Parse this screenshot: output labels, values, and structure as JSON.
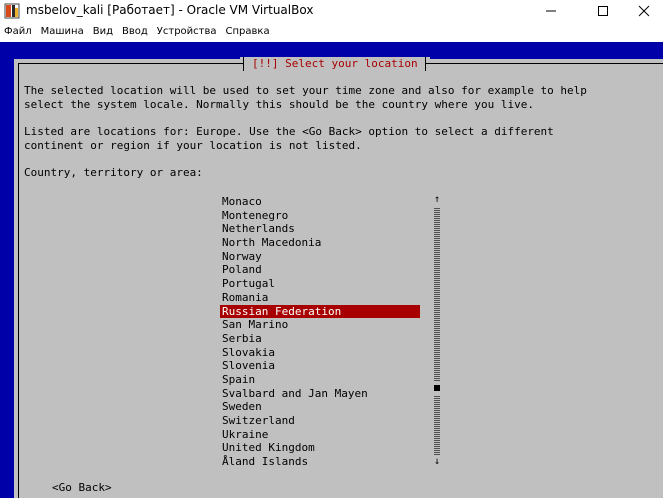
{
  "window": {
    "title": "msbelov_kali [Работает] - Oracle VM VirtualBox",
    "minimize_glyph": "–",
    "maximize_glyph": "☐",
    "close_glyph": "✕"
  },
  "menu": {
    "items": [
      "Файл",
      "Машина",
      "Вид",
      "Ввод",
      "Устройства",
      "Справка"
    ]
  },
  "installer": {
    "dialog_title": "[!!] Select your location",
    "intro_line1": "The selected location will be used to set your time zone and also for example to help",
    "intro_line2": "select the system locale. Normally this should be the country where you live.",
    "listed_line1": "Listed are locations for: Europe. Use the <Go Back> option to select a different",
    "listed_line2": "continent or region if your location is not listed.",
    "prompt": "Country, territory or area:",
    "countries": [
      "Monaco",
      "Montenegro",
      "Netherlands",
      "North Macedonia",
      "Norway",
      "Poland",
      "Portugal",
      "Romania",
      "Russian Federation",
      "San Marino",
      "Serbia",
      "Slovakia",
      "Slovenia",
      "Spain",
      "Svalbard and Jan Mayen",
      "Sweden",
      "Switzerland",
      "Ukraine",
      "United Kingdom",
      "Åland Islands"
    ],
    "selected_index": 8,
    "go_back_label": "<Go Back>",
    "scroll_up_glyph": "↑",
    "scroll_down_glyph": "↓"
  },
  "colors": {
    "vm_background": "#0000a8",
    "dialog_background": "#c0c0c0",
    "title_red": "#a80000",
    "selection_red": "#a80000"
  }
}
